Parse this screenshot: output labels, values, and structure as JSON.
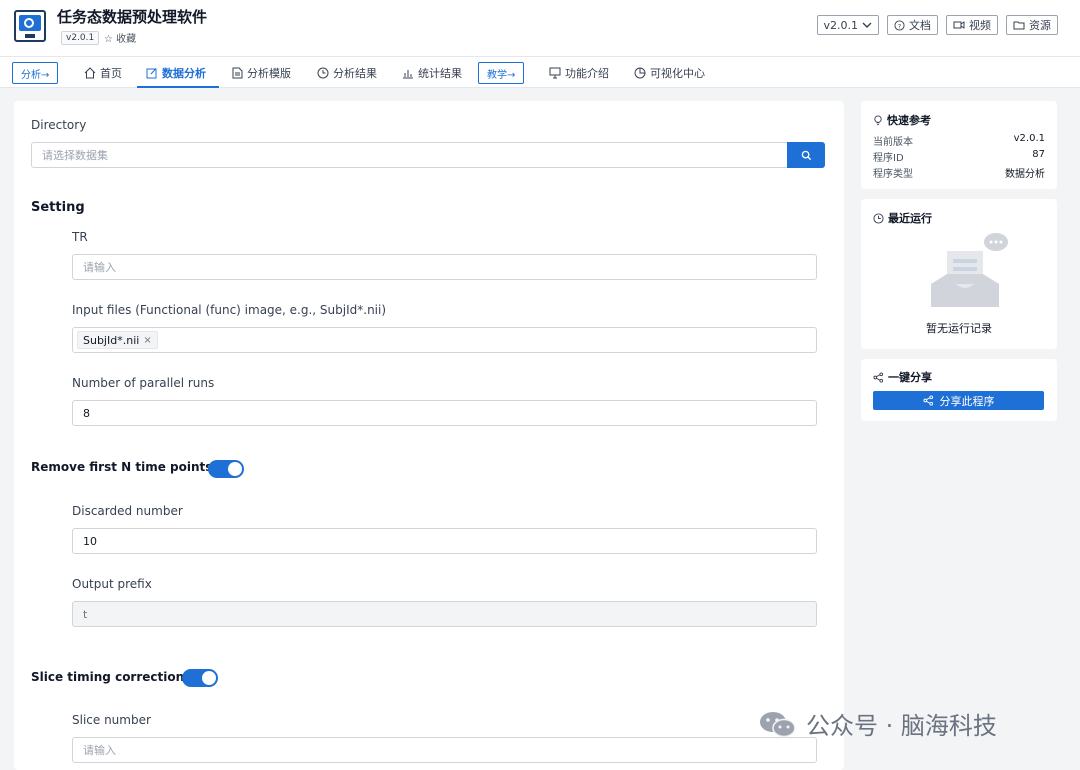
{
  "header": {
    "app_title": "任务态数据预处理软件",
    "version_badge": "v2.0.1",
    "favorite": "☆ 收藏",
    "version_select": "v2.0.1",
    "docs": "文档",
    "video": "视频",
    "resources": "资源"
  },
  "nav": {
    "tag_analysis": "分析→",
    "home": "首页",
    "data_analysis": "数据分析",
    "analysis_template": "分析模版",
    "analysis_results": "分析结果",
    "stat_results": "统计结果",
    "tag_teach": "教学→",
    "feature_intro": "功能介绍",
    "visual_center": "可视化中心"
  },
  "form": {
    "directory_label": "Directory",
    "directory_placeholder": "请选择数据集",
    "setting_title": "Setting",
    "tr_label": "TR",
    "tr_placeholder": "请输入",
    "input_files_label": "Input files (Functional (func) image, e.g., SubjId*.nii)",
    "input_files_chip": "SubjId*.nii",
    "parallel_label": "Number of parallel runs",
    "parallel_value": "8",
    "remove_title": "Remove first N time points",
    "discarded_label": "Discarded number",
    "discarded_value": "10",
    "prefix_label": "Output prefix",
    "prefix_value": "t",
    "slice_title": "Slice timing correction",
    "slice_number_label": "Slice number",
    "slice_number_placeholder": "请输入"
  },
  "quick_ref": {
    "title": "快速参考",
    "rows": [
      {
        "k": "当前版本",
        "v": "v2.0.1"
      },
      {
        "k": "程序ID",
        "v": "87"
      },
      {
        "k": "程序类型",
        "v": "数据分析"
      }
    ]
  },
  "recent": {
    "title": "最近运行",
    "empty_text": "暂无运行记录"
  },
  "share": {
    "title": "一键分享",
    "button": "分享此程序"
  },
  "watermark": "公众号 · 脑海科技",
  "colors": {
    "accent": "#1e6fd6"
  }
}
